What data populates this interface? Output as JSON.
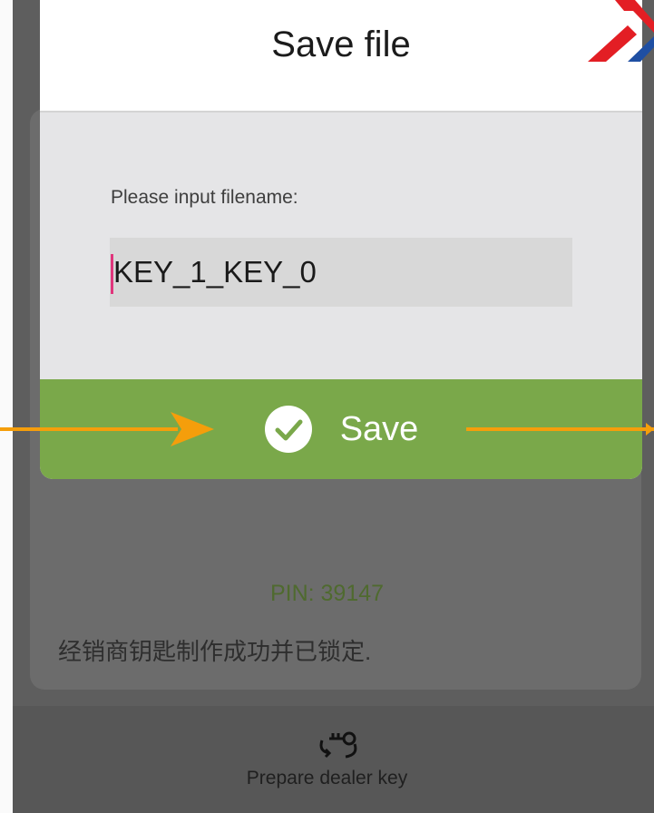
{
  "dialog": {
    "title": "Save file",
    "field_label": "Please input filename:",
    "filename_value": "KEY_1_KEY_0",
    "save_label": "Save",
    "save_icon": "check-circle-icon"
  },
  "background": {
    "pin_text": "PIN: 39147",
    "status_text": "经销商钥匙制作成功并已锁定.",
    "bottom_action": {
      "label": "Prepare dealer key",
      "icon": "key-refresh-icon"
    }
  },
  "colors": {
    "save_button": "#7aa84a",
    "arrow_annotation": "#f59e0b",
    "overlay": "#5e5e5e",
    "logo_red": "#e31e24",
    "logo_blue": "#1f4fa3"
  }
}
